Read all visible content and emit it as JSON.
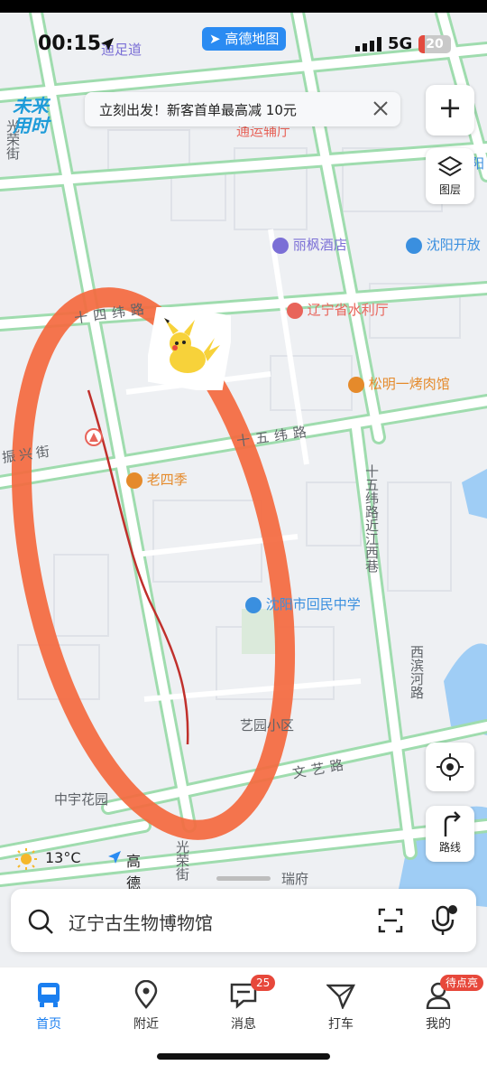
{
  "status_bar": {
    "time": "00:15",
    "network": "5G",
    "battery": "20",
    "battery_fraction": 0.2,
    "app_badge": "高德地图"
  },
  "banner": {
    "text": "立刻出发！新客首单最高减 10元"
  },
  "future_logo": {
    "line1": "未来",
    "line2": "用时"
  },
  "controls": {
    "zoom_in": "+",
    "layers_label": "图层",
    "route_label": "路线"
  },
  "map": {
    "streets": [
      "十四纬路",
      "十五纬路",
      "振兴街",
      "文艺路",
      "光荣街",
      "十五纬路近江西巷",
      "西滨河路"
    ],
    "areas": [
      "艺园小区",
      "中宇花园",
      "瑞府",
      "通运辅厅",
      "迪足道"
    ],
    "pois": [
      {
        "name": "丽枫酒店",
        "color": "#7b6fd6"
      },
      {
        "name": "沈阳开放",
        "color": "#3a8fdf"
      },
      {
        "name": "辽宁省水利厅",
        "color": "#e8645a"
      },
      {
        "name": "松明一烤肉馆",
        "color": "#e58a2b"
      },
      {
        "name": "老四季",
        "color": "#e58a2b"
      },
      {
        "name": "沈阳市回民中学",
        "color": "#3a8fdf"
      },
      {
        "name": "阳",
        "color": "#3a8fdf"
      }
    ],
    "street_vertical_1": "光荣街",
    "street_vertical_2": "光荣街"
  },
  "weather": {
    "temp": "13°C",
    "brand": "高德地图"
  },
  "search": {
    "placeholder": "辽宁古生物博物馆"
  },
  "tabs": [
    {
      "label": "首页",
      "icon": "bus-icon"
    },
    {
      "label": "附近",
      "icon": "location-pin-icon"
    },
    {
      "label": "消息",
      "icon": "message-icon",
      "badge": "25"
    },
    {
      "label": "打车",
      "icon": "taxi-icon"
    },
    {
      "label": "我的",
      "icon": "profile-icon",
      "badge": "待点亮"
    }
  ],
  "colors": {
    "accent": "#1b7ff0",
    "road": "#ffffff",
    "road_edge": "#9fdcae",
    "annotation": "#f4693f"
  }
}
